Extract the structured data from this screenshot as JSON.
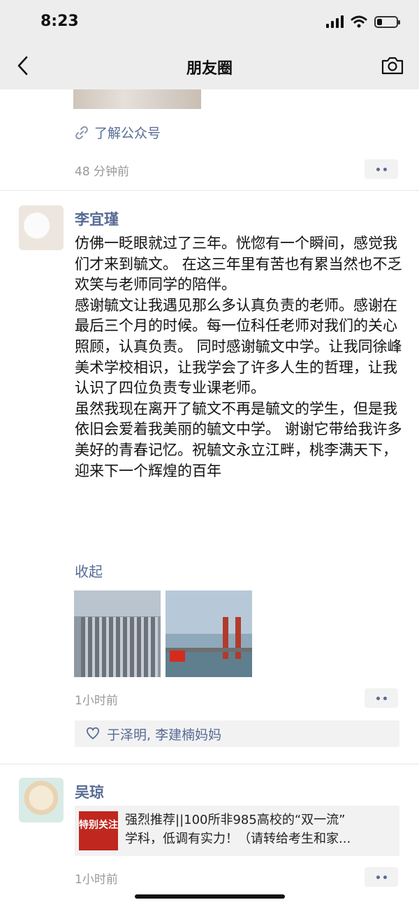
{
  "status_bar": {
    "time": "8:23"
  },
  "nav": {
    "title": "朋友圈"
  },
  "previous_post": {
    "link_label": "了解公众号",
    "time": "48 分钟前"
  },
  "post1": {
    "user": "李宜瑾",
    "paragraphs": [
      "仿佛一眨眼就过了三年。恍惚有一个瞬间，感觉我们才来到毓文。 在这三年里有苦也有累当然也不乏欢笑与老师同学的陪伴。",
      "感谢毓文让我遇见那么多认真负责的老师。感谢在最后三个月的时候。每一位科任老师对我们的关心照顾，认真负责。 同时感谢毓文中学。让我同徐峰美术学校相识，让我学会了许多人生的哲理，让我认识了四位负责专业课老师。",
      "虽然我现在离开了毓文不再是毓文的学生，但是我依旧会爱着我美丽的毓文中学。 谢谢它带给我许多美好的青春记忆。祝毓文永立江畔，桃李满天下，迎来下一个辉煌的百年"
    ],
    "collapse_label": "收起",
    "time": "1小时前",
    "likes": "于泽明, 李建楠妈妈"
  },
  "post2": {
    "user": "吴琼",
    "share_thumb_text": "特别关注",
    "share_title_line1": "强烈推荐||100所非985高校的“双一流”",
    "share_title_line2": "学科，低调有实力！（请转给考生和家...",
    "time": "1小时前"
  },
  "colors": {
    "link": "#576b95",
    "bar": "#ededed",
    "meta": "#999999"
  }
}
